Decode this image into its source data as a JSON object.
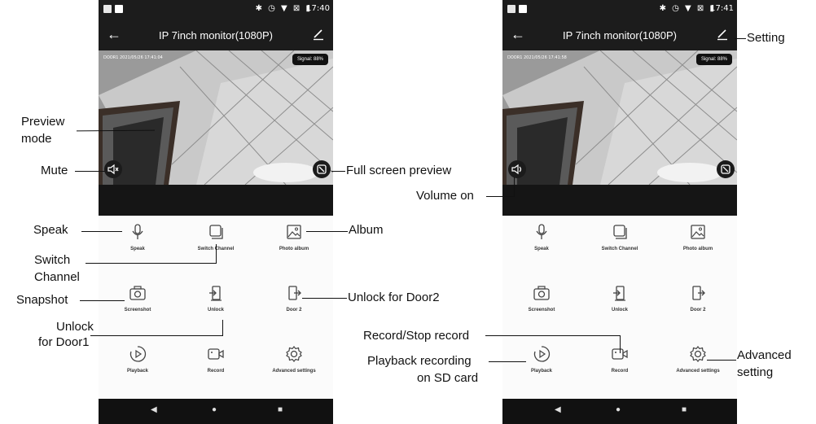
{
  "left_phone": {
    "status_time": "17:40",
    "status_icons": "✱ ◷ ▼ ⊠ ▮",
    "title": "IP 7inch monitor(1080P)",
    "osd_text": "DOOR1 2021/05/26 17:41:04",
    "signal": "Signal: 88%",
    "audio_icon": "mute-icon",
    "buttons": [
      {
        "label": "Speak",
        "icon": "microphone-icon"
      },
      {
        "label": "Switch Channel",
        "icon": "switch-channel-icon"
      },
      {
        "label": "Photo album",
        "icon": "photo-album-icon"
      },
      {
        "label": "Screenshot",
        "icon": "camera-icon"
      },
      {
        "label": "Unlock",
        "icon": "unlock-icon"
      },
      {
        "label": "Door 2",
        "icon": "door2-icon"
      },
      {
        "label": "Playback",
        "icon": "playback-icon"
      },
      {
        "label": "Record",
        "icon": "record-icon"
      },
      {
        "label": "Advanced settings",
        "icon": "gear-icon"
      }
    ]
  },
  "right_phone": {
    "status_time": "17:41",
    "status_icons": "✱ ◷ ▼ ⊠ ▮",
    "title": "IP 7inch monitor(1080P)",
    "osd_text": "DOOR1 2021/05/26 17:41:58",
    "signal": "Signal: 88%",
    "audio_icon": "volume-icon",
    "buttons": [
      {
        "label": "Speak",
        "icon": "microphone-icon"
      },
      {
        "label": "Switch Channel",
        "icon": "switch-channel-icon"
      },
      {
        "label": "Photo album",
        "icon": "photo-album-icon"
      },
      {
        "label": "Screenshot",
        "icon": "camera-icon"
      },
      {
        "label": "Unlock",
        "icon": "unlock-icon"
      },
      {
        "label": "Door 2",
        "icon": "door2-icon"
      },
      {
        "label": "Playback",
        "icon": "playback-icon"
      },
      {
        "label": "Record",
        "icon": "record-icon"
      },
      {
        "label": "Advanced settings",
        "icon": "gear-icon"
      }
    ]
  },
  "annotations": {
    "preview_mode_1": "Preview",
    "preview_mode_2": "mode",
    "mute": "Mute",
    "full_screen": "Full screen preview",
    "speak": "Speak",
    "album": "Album",
    "switch_channel_1": "Switch",
    "switch_channel_2": "Channel",
    "snapshot": "Snapshot",
    "unlock_door2": "Unlock for Door2",
    "unlock_door1_1": "Unlock",
    "unlock_door1_2": "for Door1",
    "setting": "Setting",
    "volume_on": "Volume on",
    "record_stop": "Record/Stop record",
    "playback_1": "Playback recording",
    "playback_2": "on SD card",
    "advanced_1": "Advanced",
    "advanced_2": "setting"
  }
}
